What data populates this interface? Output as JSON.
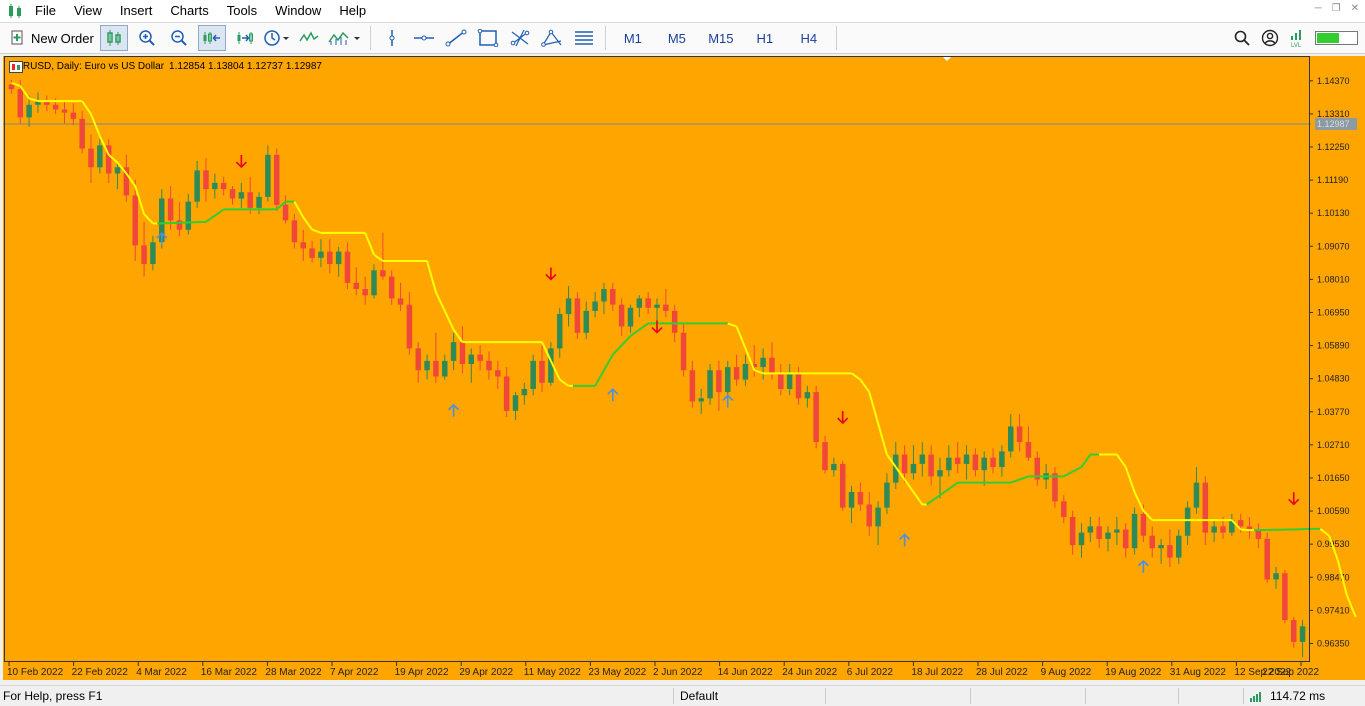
{
  "menu": [
    "File",
    "View",
    "Insert",
    "Charts",
    "Tools",
    "Window",
    "Help"
  ],
  "toolbar": {
    "new_order": "New Order",
    "timeframes": [
      "M1",
      "M5",
      "M15",
      "H1",
      "H4"
    ]
  },
  "chart": {
    "symbol_label": "EURUSD, Daily:  Euro vs US Dollar",
    "ohlc": "1.12854 1.13804 1.12737 1.12987",
    "current_price": "1.12987",
    "background": "#FFA500",
    "bull_color": "#2E8B57",
    "bear_color": "#F0473B",
    "line_up_color": "#32CD32",
    "line_down_color": "#FFFF00",
    "buy_arrow_color": "#4A90E2",
    "sell_arrow_color": "#E8001C"
  },
  "chart_data": {
    "type": "candlestick",
    "price_ticks": [
      "1.14370",
      "1.13310",
      "1.12250",
      "1.11190",
      "1.10130",
      "1.09070",
      "1.08010",
      "1.06950",
      "1.05890",
      "1.04830",
      "1.03770",
      "1.02710",
      "1.01650",
      "1.00590",
      "0.99530",
      "0.98470",
      "0.97410",
      "0.96350"
    ],
    "date_ticks": [
      "10 Feb 2022",
      "22 Feb 2022",
      "4 Mar 2022",
      "16 Mar 2022",
      "28 Mar 2022",
      "7 Apr 2022",
      "19 Apr 2022",
      "29 Apr 2022",
      "11 May 2022",
      "23 May 2022",
      "2 Jun 2022",
      "14 Jun 2022",
      "24 Jun 2022",
      "6 Jul 2022",
      "18 Jul 2022",
      "28 Jul 2022",
      "9 Aug 2022",
      "19 Aug 2022",
      "31 Aug 2022",
      "12 Sep 2022",
      "22 Sep 2022"
    ],
    "ylim": [
      0.9582,
      1.151
    ],
    "horizontal_line": 1.12987,
    "candles": [
      [
        1.1425,
        1.144,
        1.1395,
        1.141
      ],
      [
        1.141,
        1.144,
        1.13,
        1.132
      ],
      [
        1.132,
        1.139,
        1.129,
        1.136
      ],
      [
        1.136,
        1.14,
        1.1335,
        1.137
      ],
      [
        1.137,
        1.139,
        1.134,
        1.136
      ],
      [
        1.136,
        1.138,
        1.133,
        1.1345
      ],
      [
        1.1345,
        1.1375,
        1.13,
        1.1335
      ],
      [
        1.1335,
        1.1365,
        1.1295,
        1.1315
      ],
      [
        1.1315,
        1.134,
        1.1205,
        1.122
      ],
      [
        1.122,
        1.1265,
        1.111,
        1.116
      ],
      [
        1.116,
        1.125,
        1.114,
        1.123
      ],
      [
        1.123,
        1.125,
        1.111,
        1.114
      ],
      [
        1.114,
        1.1175,
        1.109,
        1.116
      ],
      [
        1.116,
        1.12,
        1.105,
        1.107
      ],
      [
        1.107,
        1.112,
        1.086,
        1.091
      ],
      [
        1.091,
        1.0985,
        1.081,
        1.085
      ],
      [
        1.085,
        1.094,
        1.083,
        1.092
      ],
      [
        1.092,
        1.109,
        1.09,
        1.106
      ],
      [
        1.106,
        1.11,
        1.096,
        1.099
      ],
      [
        1.099,
        1.105,
        1.094,
        1.096
      ],
      [
        1.096,
        1.1075,
        1.0945,
        1.105
      ],
      [
        1.105,
        1.118,
        1.103,
        1.115
      ],
      [
        1.115,
        1.119,
        1.105,
        1.109
      ],
      [
        1.109,
        1.114,
        1.106,
        1.111
      ],
      [
        1.111,
        1.113,
        1.107,
        1.109
      ],
      [
        1.109,
        1.11,
        1.104,
        1.106
      ],
      [
        1.106,
        1.111,
        1.103,
        1.108
      ],
      [
        1.108,
        1.113,
        1.101,
        1.103
      ],
      [
        1.103,
        1.108,
        1.101,
        1.1065
      ],
      [
        1.1065,
        1.123,
        1.105,
        1.12
      ],
      [
        1.12,
        1.122,
        1.102,
        1.104
      ],
      [
        1.104,
        1.107,
        1.098,
        1.099
      ],
      [
        1.099,
        1.101,
        1.09,
        1.092
      ],
      [
        1.092,
        1.096,
        1.086,
        1.09
      ],
      [
        1.09,
        1.0925,
        1.0855,
        1.087
      ],
      [
        1.087,
        1.093,
        1.084,
        1.089
      ],
      [
        1.089,
        1.093,
        1.082,
        1.085
      ],
      [
        1.085,
        1.0905,
        1.081,
        1.089
      ],
      [
        1.089,
        1.092,
        1.077,
        1.079
      ],
      [
        1.079,
        1.084,
        1.075,
        1.077
      ],
      [
        1.077,
        1.081,
        1.072,
        1.075
      ],
      [
        1.075,
        1.085,
        1.074,
        1.083
      ],
      [
        1.083,
        1.095,
        1.08,
        1.081
      ],
      [
        1.081,
        1.083,
        1.072,
        1.074
      ],
      [
        1.074,
        1.079,
        1.07,
        1.072
      ],
      [
        1.072,
        1.076,
        1.056,
        1.058
      ],
      [
        1.058,
        1.06,
        1.047,
        1.051
      ],
      [
        1.051,
        1.056,
        1.048,
        1.054
      ],
      [
        1.054,
        1.063,
        1.047,
        1.049
      ],
      [
        1.049,
        1.056,
        1.048,
        1.054
      ],
      [
        1.054,
        1.063,
        1.051,
        1.06
      ],
      [
        1.06,
        1.065,
        1.05,
        1.053
      ],
      [
        1.053,
        1.058,
        1.047,
        1.056
      ],
      [
        1.056,
        1.059,
        1.051,
        1.054
      ],
      [
        1.054,
        1.057,
        1.048,
        1.051
      ],
      [
        1.051,
        1.054,
        1.045,
        1.049
      ],
      [
        1.049,
        1.052,
        1.036,
        1.038
      ],
      [
        1.038,
        1.044,
        1.035,
        1.043
      ],
      [
        1.043,
        1.047,
        1.04,
        1.045
      ],
      [
        1.045,
        1.056,
        1.043,
        1.054
      ],
      [
        1.054,
        1.059,
        1.044,
        1.047
      ],
      [
        1.047,
        1.06,
        1.046,
        1.058
      ],
      [
        1.058,
        1.071,
        1.055,
        1.069
      ],
      [
        1.069,
        1.078,
        1.065,
        1.074
      ],
      [
        1.074,
        1.076,
        1.061,
        1.063
      ],
      [
        1.063,
        1.073,
        1.061,
        1.07
      ],
      [
        1.07,
        1.076,
        1.068,
        1.073
      ],
      [
        1.073,
        1.079,
        1.069,
        1.077
      ],
      [
        1.077,
        1.079,
        1.07,
        1.072
      ],
      [
        1.072,
        1.074,
        1.062,
        1.065
      ],
      [
        1.065,
        1.072,
        1.063,
        1.071
      ],
      [
        1.071,
        1.075,
        1.068,
        1.074
      ],
      [
        1.074,
        1.076,
        1.069,
        1.071
      ],
      [
        1.071,
        1.074,
        1.065,
        1.072
      ],
      [
        1.072,
        1.077,
        1.068,
        1.07
      ],
      [
        1.07,
        1.072,
        1.06,
        1.063
      ],
      [
        1.063,
        1.066,
        1.049,
        1.051
      ],
      [
        1.051,
        1.054,
        1.039,
        1.041
      ],
      [
        1.041,
        1.045,
        1.037,
        1.042
      ],
      [
        1.042,
        1.053,
        1.04,
        1.051
      ],
      [
        1.051,
        1.054,
        1.038,
        1.044
      ],
      [
        1.044,
        1.054,
        1.042,
        1.052
      ],
      [
        1.052,
        1.056,
        1.046,
        1.048
      ],
      [
        1.048,
        1.056,
        1.046,
        1.053
      ],
      [
        1.053,
        1.059,
        1.049,
        1.052
      ],
      [
        1.052,
        1.058,
        1.048,
        1.055
      ],
      [
        1.055,
        1.06,
        1.048,
        1.05
      ],
      [
        1.05,
        1.053,
        1.043,
        1.045
      ],
      [
        1.045,
        1.053,
        1.043,
        1.05
      ],
      [
        1.05,
        1.052,
        1.04,
        1.042
      ],
      [
        1.042,
        1.046,
        1.039,
        1.044
      ],
      [
        1.044,
        1.046,
        1.026,
        1.028
      ],
      [
        1.028,
        1.03,
        1.018,
        1.019
      ],
      [
        1.019,
        1.023,
        1.017,
        1.021
      ],
      [
        1.021,
        1.022,
        1.006,
        1.007
      ],
      [
        1.007,
        1.014,
        1.002,
        1.012
      ],
      [
        1.012,
        1.015,
        1.006,
        1.008
      ],
      [
        1.008,
        1.012,
        0.998,
        1.001
      ],
      [
        1.001,
        1.009,
        0.995,
        1.007
      ],
      [
        1.007,
        1.018,
        1.005,
        1.015
      ],
      [
        1.015,
        1.028,
        1.013,
        1.024
      ],
      [
        1.024,
        1.027,
        1.015,
        1.018
      ],
      [
        1.018,
        1.027,
        1.016,
        1.021
      ],
      [
        1.021,
        1.028,
        1.017,
        1.024
      ],
      [
        1.024,
        1.027,
        1.014,
        1.017
      ],
      [
        1.017,
        1.023,
        1.01,
        1.019
      ],
      [
        1.019,
        1.027,
        1.017,
        1.023
      ],
      [
        1.023,
        1.028,
        1.018,
        1.021
      ],
      [
        1.021,
        1.027,
        1.016,
        1.024
      ],
      [
        1.024,
        1.026,
        1.017,
        1.019
      ],
      [
        1.019,
        1.025,
        1.014,
        1.023
      ],
      [
        1.023,
        1.026,
        1.018,
        1.02
      ],
      [
        1.02,
        1.027,
        1.017,
        1.025
      ],
      [
        1.025,
        1.037,
        1.023,
        1.033
      ],
      [
        1.033,
        1.037,
        1.025,
        1.028
      ],
      [
        1.028,
        1.033,
        1.022,
        1.023
      ],
      [
        1.023,
        1.025,
        1.014,
        1.016
      ],
      [
        1.016,
        1.021,
        1.013,
        1.018
      ],
      [
        1.018,
        1.02,
        1.007,
        1.009
      ],
      [
        1.009,
        1.011,
        1.002,
        1.004
      ],
      [
        1.004,
        1.006,
        0.992,
        0.995
      ],
      [
        0.995,
        1.002,
        0.991,
        0.999
      ],
      [
        0.999,
        1.004,
        0.996,
        1.001
      ],
      [
        1.001,
        1.004,
        0.994,
        0.997
      ],
      [
        0.997,
        1.001,
        0.993,
        0.999
      ],
      [
        0.999,
        1.004,
        0.995,
        1.0
      ],
      [
        1.0,
        1.002,
        0.991,
        0.994
      ],
      [
        0.994,
        1.007,
        0.992,
        1.005
      ],
      [
        1.005,
        1.008,
        0.996,
        0.998
      ],
      [
        0.998,
        1.001,
        0.991,
        0.994
      ],
      [
        0.994,
        0.997,
        0.989,
        0.995
      ],
      [
        0.995,
        1.0,
        0.988,
        0.991
      ],
      [
        0.991,
        1.0,
        0.989,
        0.998
      ],
      [
        0.998,
        1.009,
        0.995,
        1.007
      ],
      [
        1.007,
        1.02,
        1.005,
        1.015
      ],
      [
        1.015,
        1.017,
        0.995,
        0.999
      ],
      [
        0.999,
        1.003,
        0.996,
        1.001
      ],
      [
        1.001,
        1.004,
        0.997,
        0.999
      ],
      [
        0.999,
        1.005,
        0.998,
        1.003
      ],
      [
        1.003,
        1.005,
        0.999,
        1.001
      ],
      [
        1.001,
        1.004,
        0.997,
        1.0
      ],
      [
        1.0,
        1.002,
        0.994,
        0.997
      ],
      [
        0.997,
        0.999,
        0.983,
        0.984
      ],
      [
        0.984,
        0.988,
        0.981,
        0.986
      ],
      [
        0.986,
        0.987,
        0.97,
        0.971
      ],
      [
        0.971,
        0.972,
        0.962,
        0.964
      ],
      [
        0.964,
        0.971,
        0.959,
        0.969
      ]
    ],
    "trend_line": [
      [
        0,
        1.143,
        "down"
      ],
      [
        1,
        1.142,
        "down"
      ],
      [
        2,
        1.138,
        "down"
      ],
      [
        3,
        1.1372,
        "down"
      ],
      [
        8,
        1.1372,
        "down"
      ],
      [
        9,
        1.133,
        "down"
      ],
      [
        10,
        1.126,
        "down"
      ],
      [
        11,
        1.12,
        "down"
      ],
      [
        12,
        1.1175,
        "down"
      ],
      [
        13,
        1.114,
        "down"
      ],
      [
        14,
        1.11,
        "down"
      ],
      [
        15,
        1.101,
        "down"
      ],
      [
        16,
        1.098,
        "down"
      ],
      [
        16.5,
        1.098,
        "up"
      ],
      [
        22,
        1.0985,
        "up"
      ],
      [
        24,
        1.1025,
        "up"
      ],
      [
        30,
        1.1025,
        "up"
      ],
      [
        31,
        1.105,
        "up"
      ],
      [
        32,
        1.105,
        "down"
      ],
      [
        33,
        1.1,
        "down"
      ],
      [
        34,
        1.096,
        "down"
      ],
      [
        35,
        1.095,
        "down"
      ],
      [
        40,
        1.095,
        "down"
      ],
      [
        41,
        1.088,
        "down"
      ],
      [
        42,
        1.086,
        "down"
      ],
      [
        47,
        1.086,
        "down"
      ],
      [
        48,
        1.076,
        "down"
      ],
      [
        49,
        1.07,
        "down"
      ],
      [
        50,
        1.064,
        "down"
      ],
      [
        51,
        1.06,
        "down"
      ],
      [
        60,
        1.06,
        "down"
      ],
      [
        61,
        1.054,
        "down"
      ],
      [
        62,
        1.048,
        "down"
      ],
      [
        63,
        1.046,
        "down"
      ],
      [
        63.5,
        1.046,
        "up"
      ],
      [
        66,
        1.046,
        "up"
      ],
      [
        68,
        1.056,
        "up"
      ],
      [
        70,
        1.062,
        "up"
      ],
      [
        72,
        1.066,
        "up"
      ],
      [
        80,
        1.066,
        "up"
      ],
      [
        81,
        1.066,
        "down"
      ],
      [
        82,
        1.065,
        "down"
      ],
      [
        83,
        1.058,
        "down"
      ],
      [
        84,
        1.051,
        "down"
      ],
      [
        85,
        1.05,
        "down"
      ],
      [
        95,
        1.05,
        "down"
      ],
      [
        96,
        1.048,
        "down"
      ],
      [
        97,
        1.044,
        "down"
      ],
      [
        98,
        1.034,
        "down"
      ],
      [
        99,
        1.024,
        "down"
      ],
      [
        100,
        1.02,
        "down"
      ],
      [
        101,
        1.016,
        "down"
      ],
      [
        102,
        1.012,
        "down"
      ],
      [
        103,
        1.008,
        "down"
      ],
      [
        103.5,
        1.008,
        "up"
      ],
      [
        104,
        1.009,
        "up"
      ],
      [
        106,
        1.013,
        "up"
      ],
      [
        107,
        1.015,
        "up"
      ],
      [
        113,
        1.015,
        "up"
      ],
      [
        115,
        1.017,
        "up"
      ],
      [
        119,
        1.017,
        "up"
      ],
      [
        121,
        1.02,
        "up"
      ],
      [
        122,
        1.024,
        "up"
      ],
      [
        123,
        1.024,
        "down"
      ],
      [
        125,
        1.024,
        "down"
      ],
      [
        126,
        1.02,
        "down"
      ],
      [
        127,
        1.012,
        "down"
      ],
      [
        128,
        1.006,
        "down"
      ],
      [
        129,
        1.003,
        "down"
      ],
      [
        138,
        1.003,
        "down"
      ],
      [
        139,
        1.0,
        "down"
      ],
      [
        140,
        0.9998,
        "down"
      ],
      [
        140.5,
        0.9998,
        "up"
      ],
      [
        145,
        1.0,
        "up"
      ],
      [
        147,
        1.0002,
        "up"
      ],
      [
        148,
        1.0002,
        "down"
      ],
      [
        149,
        0.998,
        "down"
      ],
      [
        150,
        0.99,
        "down"
      ],
      [
        151,
        0.979,
        "down"
      ],
      [
        152,
        0.972,
        "down"
      ]
    ],
    "buy_arrows": [
      [
        17,
        1.093
      ],
      [
        50,
        1.038
      ],
      [
        68,
        1.043
      ],
      [
        81,
        1.041
      ],
      [
        101,
        0.9965
      ],
      [
        128,
        0.988
      ]
    ],
    "sell_arrows": [
      [
        26,
        1.118
      ],
      [
        61,
        1.082
      ],
      [
        73,
        1.065
      ],
      [
        94,
        1.036
      ],
      [
        145,
        1.01
      ],
      [
        154,
        1.005
      ]
    ]
  },
  "status": {
    "help": "For Help, press F1",
    "profile": "Default",
    "ping": "114.72 ms"
  }
}
